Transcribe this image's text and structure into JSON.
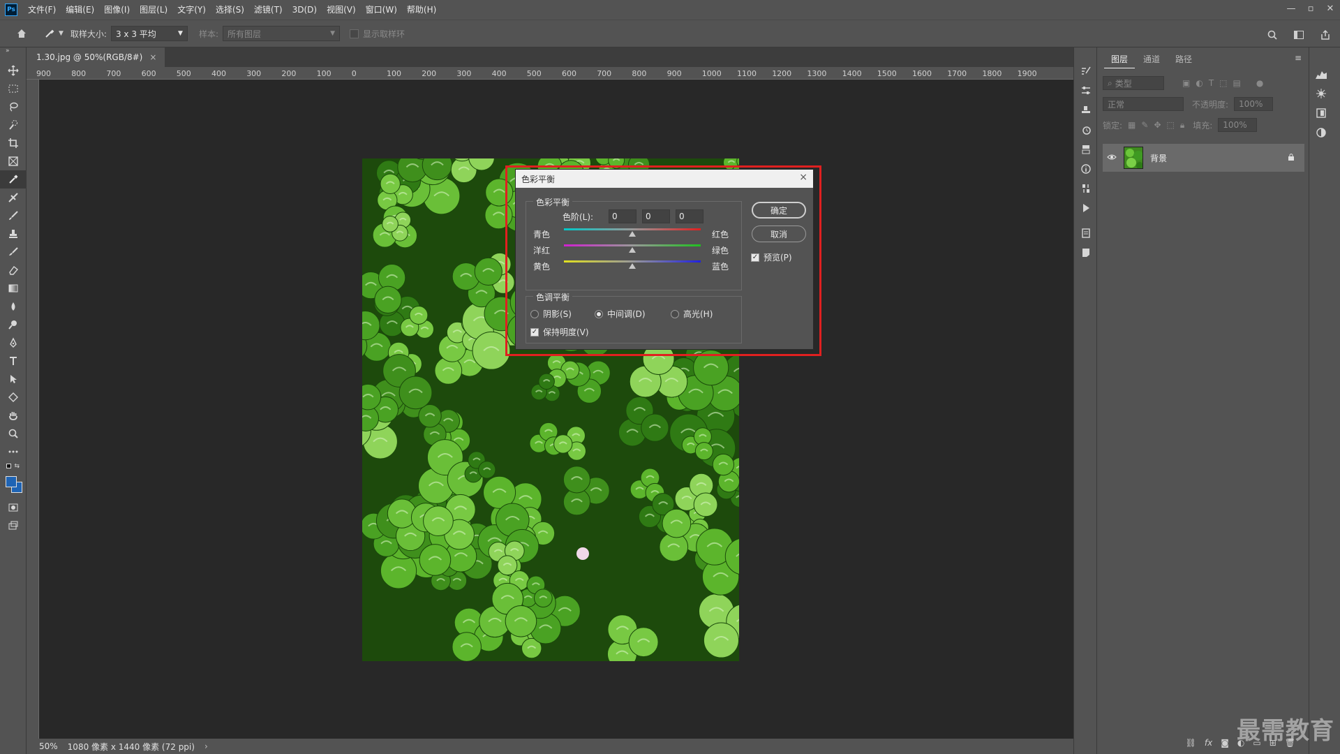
{
  "app": {
    "logo": "Ps"
  },
  "menu": [
    "文件(F)",
    "编辑(E)",
    "图像(I)",
    "图层(L)",
    "文字(Y)",
    "选择(S)",
    "滤镜(T)",
    "3D(D)",
    "视图(V)",
    "窗口(W)",
    "帮助(H)"
  ],
  "options": {
    "sample_size_label": "取样大小:",
    "sample_size_value": "3 x 3 平均",
    "sample_label": "样本:",
    "sample_value": "所有图层",
    "show_ring_label": "显示取样环"
  },
  "document": {
    "tab_title": "1.30.jpg @ 50%(RGB/8#)",
    "close": "×"
  },
  "ruler": {
    "top_ticks": [
      "900",
      "800",
      "700",
      "600",
      "500",
      "400",
      "300",
      "200",
      "100",
      "0",
      "100",
      "200",
      "300",
      "400",
      "500",
      "600",
      "700",
      "800",
      "900",
      "1000",
      "1100",
      "1200",
      "1300",
      "1400",
      "1500",
      "1600",
      "1700",
      "1800",
      "1900"
    ]
  },
  "status": {
    "zoom": "50%",
    "info": "1080 像素 x 1440 像素 (72 ppi)"
  },
  "layers_panel": {
    "tabs": [
      "图层",
      "通道",
      "路径"
    ],
    "filter_placeholder": "类型",
    "blend_mode": "正常",
    "opacity_label": "不透明度:",
    "opacity_value": "100%",
    "lock_label": "锁定:",
    "fill_label": "填充:",
    "fill_value": "100%",
    "layer_name": "背景"
  },
  "dialog": {
    "title": "色彩平衡",
    "close": "×",
    "group_color_balance": "色彩平衡",
    "levels_label": "色阶(L):",
    "levels": [
      "0",
      "0",
      "0"
    ],
    "sliders": [
      {
        "left": "青色",
        "right": "红色",
        "gradient_from": "#00c8c8",
        "gradient_to": "#e02020"
      },
      {
        "left": "洋红",
        "right": "绿色",
        "gradient_from": "#d020d0",
        "gradient_to": "#20c020"
      },
      {
        "left": "黄色",
        "right": "蓝色",
        "gradient_from": "#e0e020",
        "gradient_to": "#2020e0"
      }
    ],
    "group_tone_balance": "色调平衡",
    "tones": [
      "阴影(S)",
      "中间调(D)",
      "高光(H)"
    ],
    "tone_selected": "中间调(D)",
    "preserve_luminosity": "保持明度(V)",
    "ok": "确定",
    "cancel": "取消",
    "preview": "预览(P)"
  },
  "watermark": "最需教育",
  "colors": {
    "foreground": "#1f64b4",
    "background": "#1f64b4",
    "highlight": "#e02020"
  }
}
